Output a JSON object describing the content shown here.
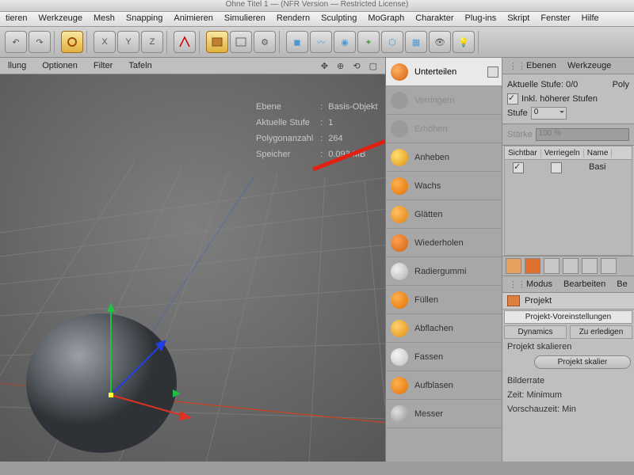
{
  "title": "Ohne Titel 1 — (NFR Version — Restricted License)",
  "menu": [
    "tieren",
    "Werkzeuge",
    "Mesh",
    "Snapping",
    "Animieren",
    "Simulieren",
    "Rendern",
    "Sculpting",
    "MoGraph",
    "Charakter",
    "Plug-ins",
    "Skript",
    "Fenster",
    "Hilfe"
  ],
  "subbar": [
    "llung",
    "Optionen",
    "Filter",
    "Tafeln"
  ],
  "hud": {
    "ebene_l": "Ebene",
    "ebene_v": "Basis-Objekt",
    "stufe_l": "Aktuelle Stufe",
    "stufe_v": "1",
    "poly_l": "Polygonanzahl",
    "poly_v": "264",
    "mem_l": "Speicher",
    "mem_v": "0.093 MB"
  },
  "sculpt": [
    {
      "label": "Unterteilen",
      "sel": true,
      "color": "radial-gradient(circle at 35% 35%,#ffb060,#d06010)"
    },
    {
      "label": "Verringern",
      "dim": true,
      "color": "#9a9a9a"
    },
    {
      "label": "Erhöhen",
      "dim": true,
      "color": "#9a9a9a"
    },
    {
      "label": "Anheben",
      "color": "radial-gradient(circle at 35% 35%,#ffe070,#e09010)"
    },
    {
      "label": "Wachs",
      "color": "radial-gradient(circle at 35% 35%,#ffb050,#e07000)"
    },
    {
      "label": "Glätten",
      "color": "radial-gradient(circle at 35% 35%,#ffc060,#e08010)"
    },
    {
      "label": "Wiederholen",
      "color": "radial-gradient(circle at 35% 35%,#ffa050,#d06010)"
    },
    {
      "label": "Radiergummi",
      "color": "radial-gradient(circle at 35% 35%,#f0f0f0,#b0b0b0)"
    },
    {
      "label": "Füllen",
      "color": "radial-gradient(circle at 35% 35%,#ffb050,#e07000)"
    },
    {
      "label": "Abflachen",
      "color": "radial-gradient(circle at 35% 35%,#ffd070,#e09010)"
    },
    {
      "label": "Fassen",
      "color": "radial-gradient(circle at 35% 35%,#f4f4f4,#c0c0c0)"
    },
    {
      "label": "Aufblasen",
      "color": "radial-gradient(circle at 35% 35%,#ffb050,#e07000)"
    },
    {
      "label": "Messer",
      "color": "radial-gradient(circle at 35% 35%,#e0e0e0,#909090)"
    }
  ],
  "side": {
    "tabs1": [
      "Ebenen",
      "Werkzeuge"
    ],
    "aktuelle": "Aktuelle Stufe: 0/0",
    "poly": "Poly",
    "inkl": "Inkl. höherer Stufen",
    "stufe_l": "Stufe",
    "stufe_v": "0",
    "staerke_l": "Stärke",
    "staerke_v": "100 %",
    "cols": [
      "Sichtbar",
      "Verriegeln",
      "Name"
    ],
    "rowname": "Basi",
    "tabs2": [
      "Modus",
      "Bearbeiten",
      "Be"
    ],
    "projekt": "Projekt",
    "voreinst": "Projekt-Voreinstellungen",
    "dynamics": "Dynamics",
    "todo": "Zu erledigen",
    "skal_l": "Projekt skalieren",
    "skal_btn": "Projekt skalier",
    "bilderrate": "Bilderrate",
    "zeit": "Zeit: Minimum",
    "vorschau": "Vorschauzeit: Min"
  }
}
